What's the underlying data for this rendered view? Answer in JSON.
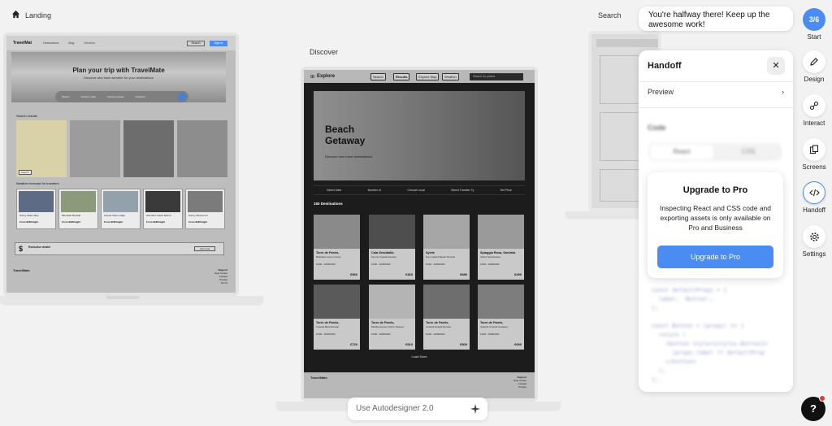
{
  "canvas": {
    "landing_label": "Landing",
    "discover_label": "Discover",
    "search_label": "Search"
  },
  "landing": {
    "brand": "TravelMat",
    "nav_links": [
      "Destinations",
      "Blog",
      "Services"
    ],
    "nav_search": "Search",
    "nav_login": "Sign in",
    "hero_title": "Plan your trip with TravelMate",
    "hero_sub": "Discover and track weather for your destinations",
    "search_fields": [
      "Search",
      "Check-in date",
      "Check-out date",
      "Travelers"
    ],
    "search_results_label": "Search results",
    "search_button": "Search",
    "weather_label": "Weather forecast for travelers",
    "weather_cards": [
      "Sunny Skies Stay",
      "Mountain Retreat",
      "Sunset View Lodge",
      "Sunshine Oasis Resort",
      "Sunny Shores Inn"
    ],
    "weather_price": "From $180/night",
    "banner_title": "Exclusive deals!",
    "banner_button": "Join now",
    "footer_brand": "TravelMate",
    "footer_links": [
      "Support",
      "Help Center",
      "Contact",
      "Privacy",
      "Terms"
    ]
  },
  "discover": {
    "brand": "Explore",
    "nav_pills": [
      "Search",
      "Results",
      "Explore Map",
      "Weather"
    ],
    "nav_search": "Search for places",
    "hero_title_line1": "Beach",
    "hero_title_line2": "Getaway",
    "hero_sub": "Discover new travel destinations!",
    "filters": [
      "Select Date",
      "Number of",
      "Choose Local",
      "Select Transfer Ty",
      "Set Price"
    ],
    "count": "150 Destinations",
    "cards": [
      {
        "name": "Torre de Parels,",
        "desc": "Beautiful ocean retreat",
        "date": "10/06 - 10/08/2023",
        "price": "€560"
      },
      {
        "name": "Cala Gravidalla",
        "desc": "Scenic Coastal Escape",
        "date": "10/06 - 10/08/2023",
        "price": "€360"
      },
      {
        "name": "Sylvie",
        "desc": "Sun-soaked Beach Retreat",
        "date": "10/06 - 10/08/2023",
        "price": "€680"
      },
      {
        "name": "Spiaggia Rosa, Sardinia",
        "desc": "Island Sea Escape",
        "date": "10/06 - 10/08/2023",
        "price": "€490"
      },
      {
        "name": "Torre de Parels,",
        "desc": "Coastal Bliss Retreat",
        "date": "10/06 - 10/08/2023",
        "price": "€720"
      },
      {
        "name": "Torre de Parels,",
        "desc": "Mediterranean Charm Retreat",
        "date": "10/06 - 10/08/2023",
        "price": "€510"
      },
      {
        "name": "Torre de Parels,",
        "desc": "Coastal Delight Retreat",
        "date": "10/06 - 10/08/2023",
        "price": "€500"
      },
      {
        "name": "Torre de Parels,",
        "desc": "Sparkle Coastal Getaway",
        "date": "10/06 - 10/08/2023",
        "price": "€690"
      }
    ],
    "load_more": "Load More",
    "footer_brand": "TravelMate",
    "footer_links": [
      "Support",
      "Help Center",
      "Contact",
      "Privacy"
    ]
  },
  "toast": "You're halfway there! Keep up the awesome work!",
  "handoff": {
    "title": "Handoff",
    "close": "✕",
    "preview": "Preview",
    "chevron": "›",
    "code": "Code",
    "tabs": [
      "React",
      "CSS"
    ],
    "code_snippet": "const defaultProps = {\n  label: 'Button',\n};\n\nconst Button = (props) => {\n  return (\n    <button style={styles.Button}>\n      {props.label ?? defaultProp\n    </button>\n  );\n};"
  },
  "upgrade": {
    "title": "Upgrade to Pro",
    "body": "Inspecting React and CSS code and exporting assets is only available on Pro and Business",
    "button": "Upgrade to Pro"
  },
  "toolbar": {
    "step": "3/6",
    "step_label": "Start",
    "items": [
      "Design",
      "Interact",
      "Screens",
      "Handoff",
      "Settings"
    ]
  },
  "autodesigner": "Use Autodesigner 2.0",
  "help": "?",
  "colors": {
    "accent": "#4a8cf2",
    "alert": "#e53935"
  }
}
